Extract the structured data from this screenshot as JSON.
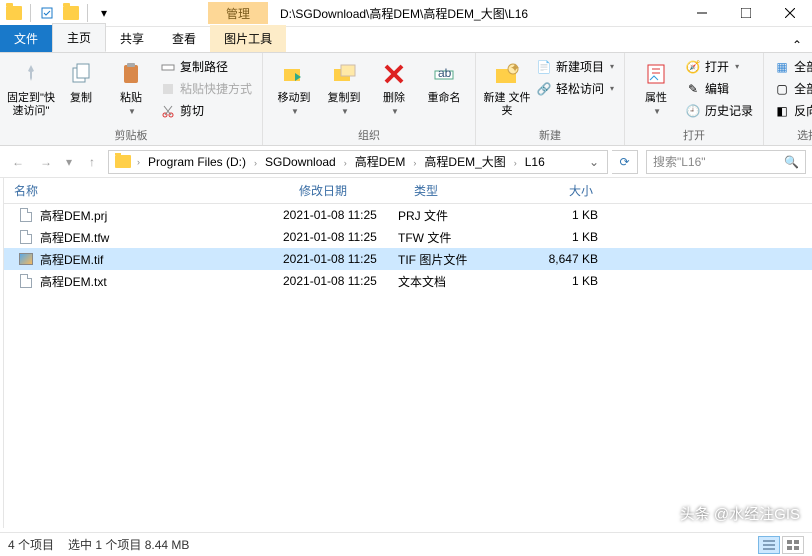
{
  "titlebar": {
    "context_tab": "管理",
    "path": "D:\\SGDownload\\高程DEM\\高程DEM_大图\\L16"
  },
  "tabs": {
    "file": "文件",
    "home": "主页",
    "share": "共享",
    "view": "查看",
    "picture": "图片工具"
  },
  "ribbon": {
    "clipboard": {
      "pin": "固定到\"快速访问\"",
      "copy": "复制",
      "paste": "粘贴",
      "copy_path": "复制路径",
      "paste_shortcut": "粘贴快捷方式",
      "cut": "剪切",
      "label": "剪贴板"
    },
    "organize": {
      "moveto": "移动到",
      "copyto": "复制到",
      "delete": "删除",
      "rename": "重命名",
      "label": "组织"
    },
    "new": {
      "newfolder": "新建\n文件夹",
      "newitem": "新建项目",
      "easyaccess": "轻松访问",
      "label": "新建"
    },
    "open": {
      "properties": "属性",
      "open": "打开",
      "edit": "编辑",
      "history": "历史记录",
      "label": "打开"
    },
    "select": {
      "all": "全部选择",
      "none": "全部取消",
      "invert": "反向选择",
      "label": "选择"
    }
  },
  "breadcrumbs": [
    "Program Files (D:)",
    "SGDownload",
    "高程DEM",
    "高程DEM_大图",
    "L16"
  ],
  "search": {
    "placeholder": "搜索\"L16\""
  },
  "columns": {
    "name": "名称",
    "date": "修改日期",
    "type": "类型",
    "size": "大小"
  },
  "files": [
    {
      "name": "高程DEM.prj",
      "date": "2021-01-08 11:25",
      "type": "PRJ 文件",
      "size": "1 KB",
      "icon": "doc",
      "selected": false
    },
    {
      "name": "高程DEM.tfw",
      "date": "2021-01-08 11:25",
      "type": "TFW 文件",
      "size": "1 KB",
      "icon": "doc",
      "selected": false
    },
    {
      "name": "高程DEM.tif",
      "date": "2021-01-08 11:25",
      "type": "TIF 图片文件",
      "size": "8,647 KB",
      "icon": "tif",
      "selected": true
    },
    {
      "name": "高程DEM.txt",
      "date": "2021-01-08 11:25",
      "type": "文本文档",
      "size": "1 KB",
      "icon": "doc",
      "selected": false
    }
  ],
  "status": {
    "count": "4 个项目",
    "selection": "选中 1 个项目  8.44 MB"
  },
  "watermark": "头条 @水经注GIS"
}
